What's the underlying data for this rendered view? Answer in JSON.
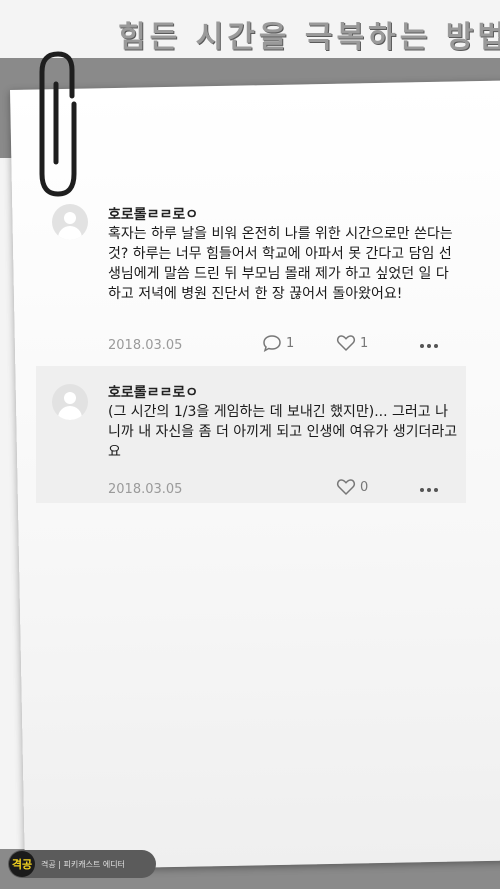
{
  "header": {
    "title": "힘든 시간을 극복하는 방법"
  },
  "comments": [
    {
      "author": "호로롤ㄹㄹ로ㅇ",
      "text": "혹자는 하루 날을 비워 온전히 나를 위한 시간으로만 쓴다는 것? 하루는 너무 힘들어서 학교에 아파서 못 간다고 담임 선생님에게 말씀 드린 뒤 부모님 몰래 제가 하고 싶었던 일 다 하고 저녁에 병원 진단서 한 장 끊어서 돌아왔어요!",
      "date": "2018.03.05",
      "replies": "1",
      "likes": "1"
    },
    {
      "author": "호로롤ㄹㄹ로ㅇ",
      "text": "(그 시간의 1/3을 게임하는 데 보내긴 했지만)... 그러고 나니까 내 자신을 좀 더 아끼게 되고 인생에 여유가 생기더라고요",
      "date": "2018.03.05",
      "likes": "0"
    }
  ],
  "badge": {
    "logo": "격공",
    "text": "격공 | 피키캐스트 에디터"
  }
}
